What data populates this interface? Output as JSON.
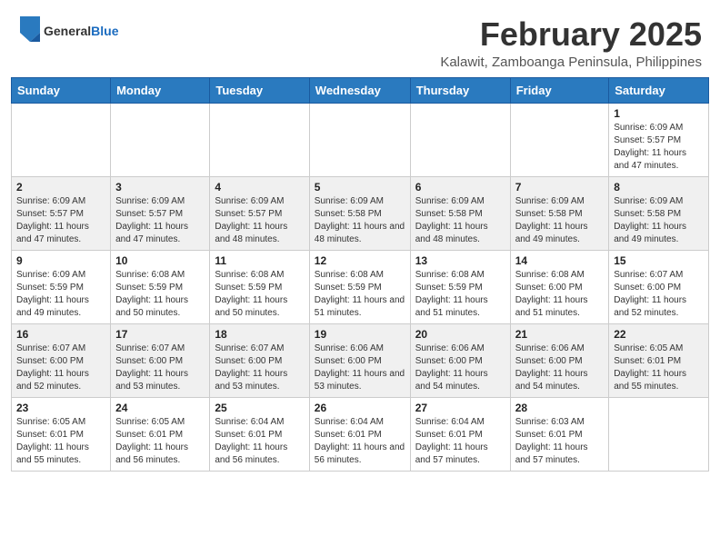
{
  "header": {
    "logo_general": "General",
    "logo_blue": "Blue",
    "month_title": "February 2025",
    "location": "Kalawit, Zamboanga Peninsula, Philippines"
  },
  "weekdays": [
    "Sunday",
    "Monday",
    "Tuesday",
    "Wednesday",
    "Thursday",
    "Friday",
    "Saturday"
  ],
  "weeks": [
    [
      {
        "day": "",
        "sunrise": "",
        "sunset": "",
        "daylight": ""
      },
      {
        "day": "",
        "sunrise": "",
        "sunset": "",
        "daylight": ""
      },
      {
        "day": "",
        "sunrise": "",
        "sunset": "",
        "daylight": ""
      },
      {
        "day": "",
        "sunrise": "",
        "sunset": "",
        "daylight": ""
      },
      {
        "day": "",
        "sunrise": "",
        "sunset": "",
        "daylight": ""
      },
      {
        "day": "",
        "sunrise": "",
        "sunset": "",
        "daylight": ""
      },
      {
        "day": "1",
        "sunrise": "Sunrise: 6:09 AM",
        "sunset": "Sunset: 5:57 PM",
        "daylight": "Daylight: 11 hours and 47 minutes."
      }
    ],
    [
      {
        "day": "2",
        "sunrise": "Sunrise: 6:09 AM",
        "sunset": "Sunset: 5:57 PM",
        "daylight": "Daylight: 11 hours and 47 minutes."
      },
      {
        "day": "3",
        "sunrise": "Sunrise: 6:09 AM",
        "sunset": "Sunset: 5:57 PM",
        "daylight": "Daylight: 11 hours and 47 minutes."
      },
      {
        "day": "4",
        "sunrise": "Sunrise: 6:09 AM",
        "sunset": "Sunset: 5:57 PM",
        "daylight": "Daylight: 11 hours and 48 minutes."
      },
      {
        "day": "5",
        "sunrise": "Sunrise: 6:09 AM",
        "sunset": "Sunset: 5:58 PM",
        "daylight": "Daylight: 11 hours and 48 minutes."
      },
      {
        "day": "6",
        "sunrise": "Sunrise: 6:09 AM",
        "sunset": "Sunset: 5:58 PM",
        "daylight": "Daylight: 11 hours and 48 minutes."
      },
      {
        "day": "7",
        "sunrise": "Sunrise: 6:09 AM",
        "sunset": "Sunset: 5:58 PM",
        "daylight": "Daylight: 11 hours and 49 minutes."
      },
      {
        "day": "8",
        "sunrise": "Sunrise: 6:09 AM",
        "sunset": "Sunset: 5:58 PM",
        "daylight": "Daylight: 11 hours and 49 minutes."
      }
    ],
    [
      {
        "day": "9",
        "sunrise": "Sunrise: 6:09 AM",
        "sunset": "Sunset: 5:59 PM",
        "daylight": "Daylight: 11 hours and 49 minutes."
      },
      {
        "day": "10",
        "sunrise": "Sunrise: 6:08 AM",
        "sunset": "Sunset: 5:59 PM",
        "daylight": "Daylight: 11 hours and 50 minutes."
      },
      {
        "day": "11",
        "sunrise": "Sunrise: 6:08 AM",
        "sunset": "Sunset: 5:59 PM",
        "daylight": "Daylight: 11 hours and 50 minutes."
      },
      {
        "day": "12",
        "sunrise": "Sunrise: 6:08 AM",
        "sunset": "Sunset: 5:59 PM",
        "daylight": "Daylight: 11 hours and 51 minutes."
      },
      {
        "day": "13",
        "sunrise": "Sunrise: 6:08 AM",
        "sunset": "Sunset: 5:59 PM",
        "daylight": "Daylight: 11 hours and 51 minutes."
      },
      {
        "day": "14",
        "sunrise": "Sunrise: 6:08 AM",
        "sunset": "Sunset: 6:00 PM",
        "daylight": "Daylight: 11 hours and 51 minutes."
      },
      {
        "day": "15",
        "sunrise": "Sunrise: 6:07 AM",
        "sunset": "Sunset: 6:00 PM",
        "daylight": "Daylight: 11 hours and 52 minutes."
      }
    ],
    [
      {
        "day": "16",
        "sunrise": "Sunrise: 6:07 AM",
        "sunset": "Sunset: 6:00 PM",
        "daylight": "Daylight: 11 hours and 52 minutes."
      },
      {
        "day": "17",
        "sunrise": "Sunrise: 6:07 AM",
        "sunset": "Sunset: 6:00 PM",
        "daylight": "Daylight: 11 hours and 53 minutes."
      },
      {
        "day": "18",
        "sunrise": "Sunrise: 6:07 AM",
        "sunset": "Sunset: 6:00 PM",
        "daylight": "Daylight: 11 hours and 53 minutes."
      },
      {
        "day": "19",
        "sunrise": "Sunrise: 6:06 AM",
        "sunset": "Sunset: 6:00 PM",
        "daylight": "Daylight: 11 hours and 53 minutes."
      },
      {
        "day": "20",
        "sunrise": "Sunrise: 6:06 AM",
        "sunset": "Sunset: 6:00 PM",
        "daylight": "Daylight: 11 hours and 54 minutes."
      },
      {
        "day": "21",
        "sunrise": "Sunrise: 6:06 AM",
        "sunset": "Sunset: 6:00 PM",
        "daylight": "Daylight: 11 hours and 54 minutes."
      },
      {
        "day": "22",
        "sunrise": "Sunrise: 6:05 AM",
        "sunset": "Sunset: 6:01 PM",
        "daylight": "Daylight: 11 hours and 55 minutes."
      }
    ],
    [
      {
        "day": "23",
        "sunrise": "Sunrise: 6:05 AM",
        "sunset": "Sunset: 6:01 PM",
        "daylight": "Daylight: 11 hours and 55 minutes."
      },
      {
        "day": "24",
        "sunrise": "Sunrise: 6:05 AM",
        "sunset": "Sunset: 6:01 PM",
        "daylight": "Daylight: 11 hours and 56 minutes."
      },
      {
        "day": "25",
        "sunrise": "Sunrise: 6:04 AM",
        "sunset": "Sunset: 6:01 PM",
        "daylight": "Daylight: 11 hours and 56 minutes."
      },
      {
        "day": "26",
        "sunrise": "Sunrise: 6:04 AM",
        "sunset": "Sunset: 6:01 PM",
        "daylight": "Daylight: 11 hours and 56 minutes."
      },
      {
        "day": "27",
        "sunrise": "Sunrise: 6:04 AM",
        "sunset": "Sunset: 6:01 PM",
        "daylight": "Daylight: 11 hours and 57 minutes."
      },
      {
        "day": "28",
        "sunrise": "Sunrise: 6:03 AM",
        "sunset": "Sunset: 6:01 PM",
        "daylight": "Daylight: 11 hours and 57 minutes."
      },
      {
        "day": "",
        "sunrise": "",
        "sunset": "",
        "daylight": ""
      }
    ]
  ]
}
